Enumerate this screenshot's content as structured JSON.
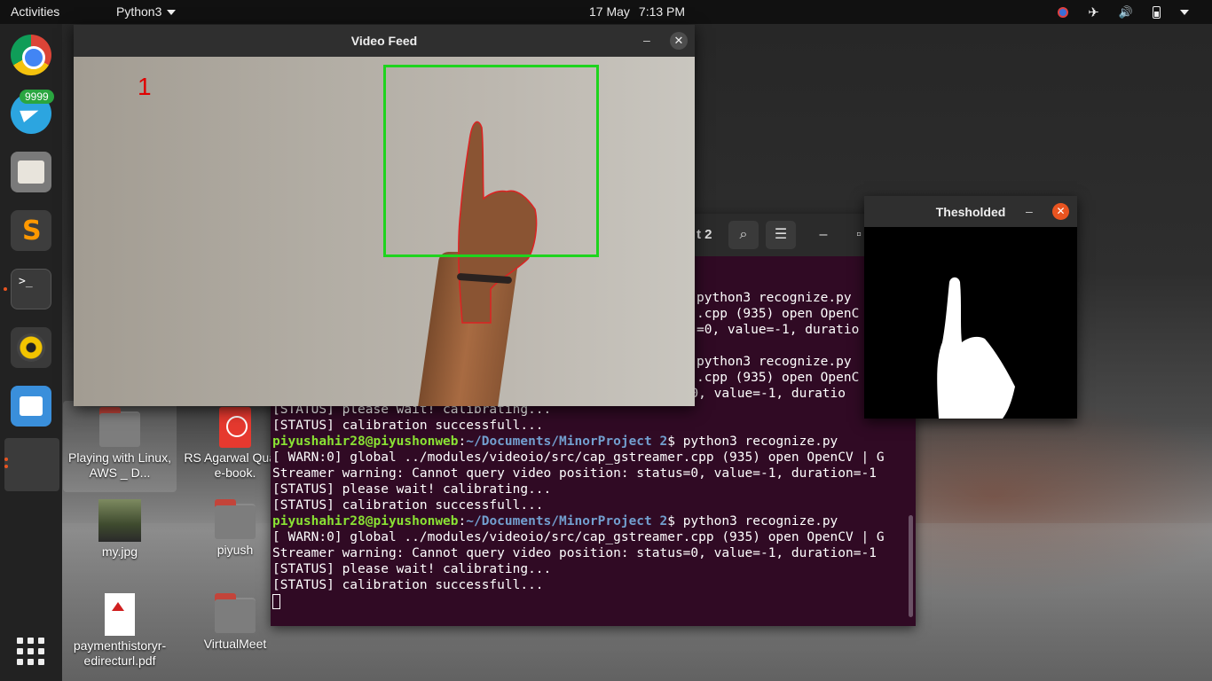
{
  "topbar": {
    "activities": "Activities",
    "app_menu": "Python3",
    "date": "17 May",
    "time": "7:13 PM",
    "tray_icons": [
      "screen-record-icon",
      "airplane-mode-icon",
      "volume-icon",
      "battery-icon",
      "system-menu-icon"
    ]
  },
  "dock": {
    "items": [
      "chrome-icon",
      "telegram-icon",
      "files-icon",
      "sublime-text-icon",
      "terminal-icon",
      "rhythmbox-icon",
      "software-center-icon",
      "python-app-icon",
      "show-applications-icon"
    ],
    "telegram_badge": "9999"
  },
  "desktop": {
    "icons": [
      {
        "label": "Playing with Linux, AWS _ D...",
        "type": "folder"
      },
      {
        "label": "RS Agarwal Quant e-book.",
        "type": "pdf"
      },
      {
        "label": "my.jpg",
        "type": "image"
      },
      {
        "label": "piyush",
        "type": "folder"
      },
      {
        "label": "paymenthistoryr-edirecturl.pdf",
        "type": "pdf"
      },
      {
        "label": "VirtualMeet",
        "type": "folder"
      }
    ]
  },
  "terminal": {
    "title": "t 2",
    "lines": [
      {
        "text": "python3 recognize.py"
      },
      {
        "text": ".cpp (935) open OpenC"
      },
      {
        "text": "=0, value=-1, duratio"
      },
      {
        "text": ""
      },
      {
        "text": "python3 recognize.py"
      },
      {
        "text": ".cpp (935) open OpenC"
      },
      {
        "text": "Streamer warning: Cannot query video position: status=0, value=-1, duratio"
      },
      {
        "text": "[STATUS] please wait! calibrating..."
      },
      {
        "text": "[STATUS] calibration successfull..."
      },
      {
        "user": "piyushahir28@piyushonweb",
        "sep": ":",
        "path": "~/Documents/MinorProject 2",
        "cmd": "$ python3 recognize.py"
      },
      {
        "text": "[ WARN:0] global ../modules/videoio/src/cap_gstreamer.cpp (935) open OpenCV | G"
      },
      {
        "text": "Streamer warning: Cannot query video position: status=0, value=-1, duration=-1"
      },
      {
        "text": "[STATUS] please wait! calibrating..."
      },
      {
        "text": "[STATUS] calibration successfull..."
      },
      {
        "user": "piyushahir28@piyushonweb",
        "sep": ":",
        "path": "~/Documents/MinorProject 2",
        "cmd": "$ python3 recognize.py"
      },
      {
        "text": "[ WARN:0] global ../modules/videoio/src/cap_gstreamer.cpp (935) open OpenCV | G"
      },
      {
        "text": "Streamer warning: Cannot query video position: status=0, value=-1, duration=-1"
      },
      {
        "text": "[STATUS] please wait! calibrating..."
      },
      {
        "text": "[STATUS] calibration successfull..."
      }
    ]
  },
  "video_feed": {
    "title": "Video Feed",
    "finger_count": "1",
    "roi_color": "#1ed41e",
    "count_color": "#e00000"
  },
  "thresholded": {
    "title": "Thesholded"
  },
  "colors": {
    "terminal_bg": "#300a24",
    "prompt_user": "#8ae234",
    "prompt_path": "#729fcf",
    "ubuntu_orange": "#e95420"
  }
}
